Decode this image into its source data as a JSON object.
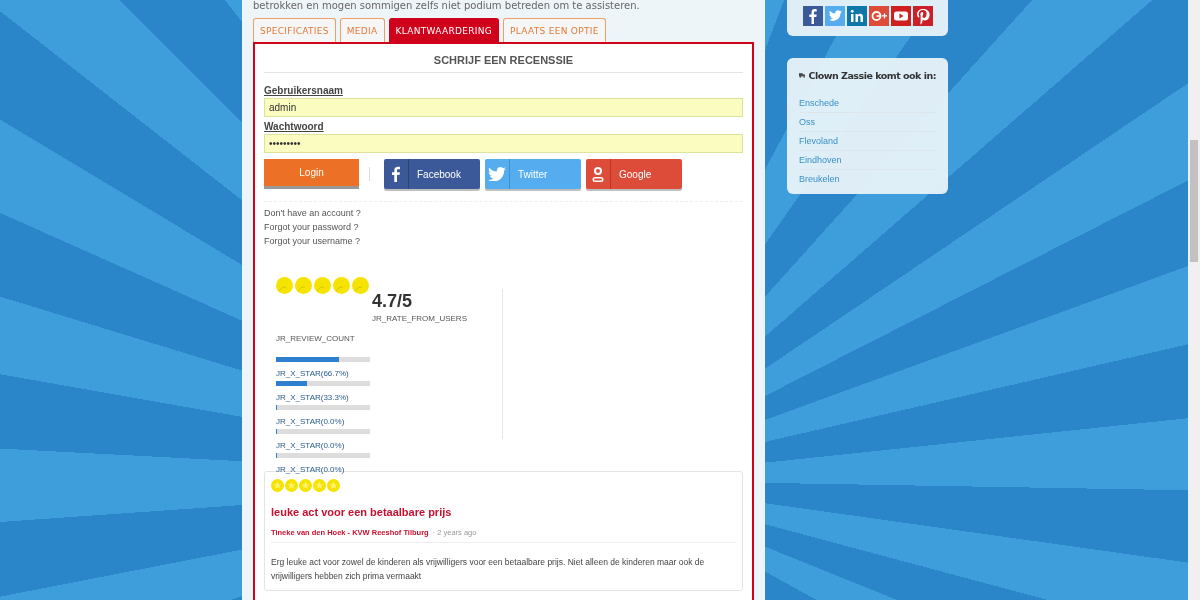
{
  "intro_text": "betrokken en mogen sommigen zelfs niet podium betreden om te assisteren.",
  "tabs": [
    {
      "label": "SPECIFICATIES",
      "selected": false
    },
    {
      "label": "MEDIA",
      "selected": false
    },
    {
      "label": "KLANTWAARDERING",
      "selected": true
    },
    {
      "label": "PLAATS EEN OPTIE",
      "selected": false
    }
  ],
  "review_form": {
    "title": "SCHRIJF EEN RECENSSIE",
    "fields": [
      {
        "label": "Gebruikersnaam",
        "value": "admin"
      },
      {
        "label": "Wachtwoord",
        "value": "•••••••••"
      }
    ],
    "login_button": "Login",
    "social_buttons": [
      {
        "label": "Facebook",
        "kind": "facebook"
      },
      {
        "label": "Twitter",
        "kind": "twitter"
      },
      {
        "label": "Google",
        "kind": "google"
      }
    ],
    "links": [
      "Don't have an account ?",
      "Forgot your password ?",
      "Forgot your username ?"
    ]
  },
  "rating_summary": {
    "stars": 5,
    "score": "4.7/5",
    "score_caption": "JR_RATE_FROM_USERS",
    "review_count": "JR_REVIEW_COUNT",
    "breakdown": [
      {
        "level": 0.667,
        "label": "JR_X_STAR(66.7%)"
      },
      {
        "level": 0.333,
        "label": "JR_X_STAR(33.3%)"
      },
      {
        "level": 0,
        "label": "JR_X_STAR(0.0%)"
      },
      {
        "level": 0,
        "label": "JR_X_STAR(0.0%)"
      },
      {
        "level": 0,
        "label": "JR_X_STAR(0.0%)"
      }
    ]
  },
  "reviews": [
    {
      "stars": 5,
      "title": "leuke act voor een betaalbare prijs",
      "author": "Tineke van den Hoek - KVW Reeshof Tilburg",
      "time": "· 2 years ago",
      "body": "Erg leuke act voor zowel de kinderen als vrijwilligers voor een betaalbare prijs. Niet alleen de kinderen maar ook de vrijwilligers hebben zich prima vermaakt"
    }
  ],
  "sidebar": {
    "social_icons": [
      {
        "kind": "facebook"
      },
      {
        "kind": "twitter"
      },
      {
        "kind": "linkedin"
      },
      {
        "kind": "googleplus"
      },
      {
        "kind": "youtube"
      },
      {
        "kind": "pinterest"
      }
    ],
    "cities_card": {
      "title": "Clown Zassie komt ook in:",
      "cities": [
        "Enschede",
        "Oss",
        "Flevoland",
        "Eindhoven",
        "Breukelen"
      ]
    }
  }
}
